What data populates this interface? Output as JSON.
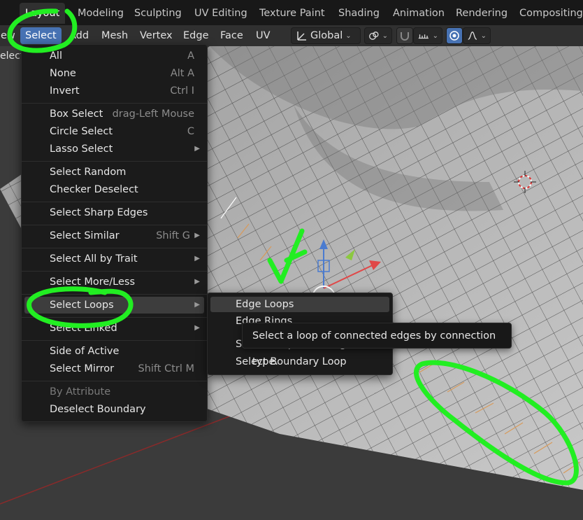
{
  "workspace_tabs": [
    "Layout",
    "Modeling",
    "Sculpting",
    "UV Editing",
    "Texture Paint",
    "Shading",
    "Animation",
    "Rendering",
    "Compositing"
  ],
  "active_workspace": "Layout",
  "header_menus": [
    "View",
    "Select",
    "Add",
    "Mesh",
    "Vertex",
    "Edge",
    "Face",
    "UV"
  ],
  "header_menus_display": {
    "view": "ew",
    "select": "Select",
    "add": "Add",
    "mesh": "Mesh",
    "vertex": "Vertex",
    "edge": "Edge",
    "face": "Face",
    "uv": "UV"
  },
  "transform_orientation": {
    "icon": "transform-orientation-icon",
    "value": "Global"
  },
  "pivot_icon": "pivot-point-icon",
  "snap_icon": "snap-magnet-icon",
  "snap_target_icon": "snap-increment-icon",
  "proportional_icon": "proportional-editing-icon",
  "falloff_icon": "falloff-curve-icon",
  "left_partial_label": "elect",
  "select_menu": {
    "groups": [
      [
        {
          "label": "All",
          "underline": "A",
          "shortcut": "A"
        },
        {
          "label": "None",
          "underline": "N",
          "shortcut": "Alt A"
        },
        {
          "label": "Invert",
          "underline": "I",
          "shortcut": "Ctrl I"
        }
      ],
      [
        {
          "label": "Box Select",
          "underline": "B",
          "shortcut": "drag-Left Mouse"
        },
        {
          "label": "Circle Select",
          "underline": "C",
          "shortcut": "C"
        },
        {
          "label": "Lasso Select",
          "underline": "L",
          "submenu": true
        }
      ],
      [
        {
          "label": "Select Random",
          "shortcut": ""
        },
        {
          "label": "Checker Deselect",
          "shortcut": ""
        }
      ],
      [
        {
          "label": "Select Sharp Edges",
          "shortcut": ""
        }
      ],
      [
        {
          "label": "Select Similar",
          "shortcut": "Shift G",
          "submenu": true
        }
      ],
      [
        {
          "label": "Select All by Trait",
          "submenu": true
        }
      ],
      [
        {
          "label": "Select More/Less",
          "submenu": true
        }
      ],
      [
        {
          "label": "Select Loops",
          "submenu": true,
          "highlighted": true
        }
      ],
      [
        {
          "label": "Select Linked",
          "submenu": true
        }
      ],
      [
        {
          "label": "Side of Active",
          "shortcut": ""
        },
        {
          "label": "Select Mirror",
          "shortcut": "Shift Ctrl M"
        }
      ],
      [
        {
          "label": "By Attribute",
          "disabled": true
        },
        {
          "label": "Deselect Boundary",
          "shortcut": ""
        }
      ]
    ]
  },
  "loops_submenu": {
    "items": [
      {
        "label": "Edge Loops",
        "highlighted": true
      },
      {
        "label": "Edge Rings"
      },
      {
        "label": "Select Loop Inner-Region"
      },
      {
        "label": "Select Boundary Loop"
      }
    ]
  },
  "tooltip": {
    "text": "Select a loop of connected edges by connection type."
  },
  "annotation": {
    "color": "#22ee22"
  }
}
